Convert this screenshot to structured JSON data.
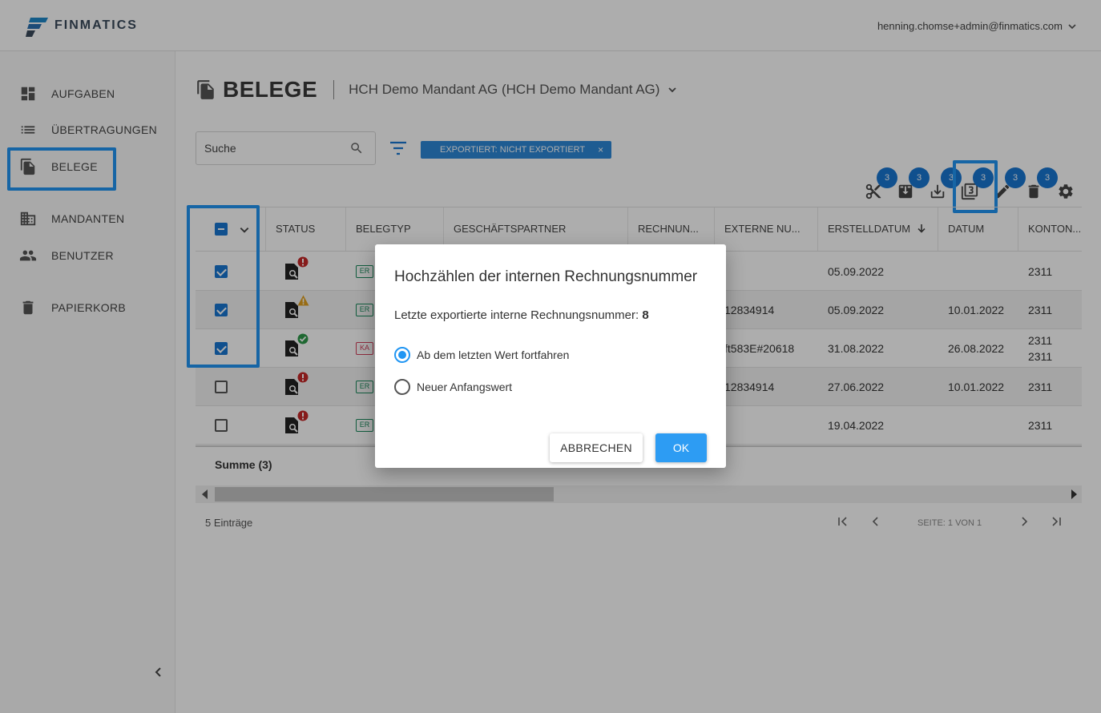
{
  "header": {
    "brand": "FINMATICS",
    "user_email": "henning.chomse+admin@finmatics.com"
  },
  "sidebar": {
    "items": [
      {
        "label": "AUFGABEN",
        "icon": "dashboard-icon"
      },
      {
        "label": "ÜBERTRAGUNGEN",
        "icon": "list-icon"
      },
      {
        "label": "BELEGE",
        "icon": "documents-icon"
      },
      {
        "label": "MANDANTEN",
        "icon": "building-icon"
      },
      {
        "label": "BENUTZER",
        "icon": "people-icon"
      },
      {
        "label": "PAPIERKORB",
        "icon": "trash-icon"
      }
    ]
  },
  "page": {
    "title": "BELEGE",
    "mandant": "HCH Demo Mandant AG (HCH Demo Mandant AG)"
  },
  "search": {
    "placeholder": "Suche"
  },
  "filter_chip": {
    "label": "EXPORTIERT: NICHT EXPORTIERT",
    "close": "×"
  },
  "toolbar": {
    "badges": [
      "3",
      "3",
      "3",
      "3",
      "3",
      "3"
    ]
  },
  "table": {
    "columns": [
      "STATUS",
      "BELEGTYP",
      "GESCHÄFTSPARTNER",
      "RECHNUN...",
      "EXTERNE NU...",
      "ERSTELLDATUM",
      "DATUM",
      "KONTON..."
    ],
    "rows": [
      {
        "checked": true,
        "status": "error",
        "type": "ER",
        "external": "",
        "created": "05.09.2022",
        "date": "",
        "account": "2311",
        "account2": ""
      },
      {
        "checked": true,
        "status": "warning",
        "type": "ER",
        "external": "12834914",
        "created": "05.09.2022",
        "date": "10.01.2022",
        "account": "2311",
        "account2": ""
      },
      {
        "checked": true,
        "status": "ok",
        "type": "KA",
        "external": "ft583E#20618",
        "created": "31.08.2022",
        "date": "26.08.2022",
        "account": "2311",
        "account2": "2311"
      },
      {
        "checked": false,
        "status": "error",
        "type": "ER",
        "external": "12834914",
        "created": "27.06.2022",
        "date": "10.01.2022",
        "account": "2311",
        "account2": ""
      },
      {
        "checked": false,
        "status": "error",
        "type": "ER",
        "external": "",
        "created": "19.04.2022",
        "date": "",
        "account": "2311",
        "account2": ""
      }
    ],
    "sum_label": "Summe (3)"
  },
  "footer": {
    "count": "5 Einträge",
    "page_info": "SEITE: 1 VON 1"
  },
  "dialog": {
    "title": "Hochzählen der internen Rechnungsnummer",
    "info_label": "Letzte exportierte interne Rechnungsnummer:",
    "info_value": "8",
    "option_continue": "Ab dem letzten Wert fortfahren",
    "option_new": "Neuer Anfangswert",
    "cancel": "ABBRECHEN",
    "ok": "OK"
  },
  "colors": {
    "accent": "#2196f3",
    "badge": "#1976d2",
    "chip": "#2d88d8",
    "error": "#c62828",
    "warning": "#e0a020",
    "ok": "#2e9a4a"
  }
}
